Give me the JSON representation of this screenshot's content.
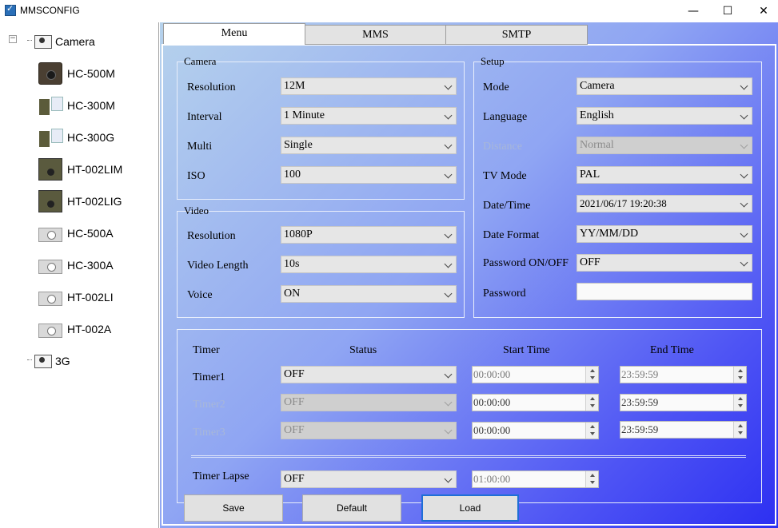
{
  "window": {
    "title": "MMSCONFIG",
    "minimize": "—",
    "maximize": "☐",
    "close": "✕"
  },
  "sidebar": {
    "expander": "−",
    "root": "Camera",
    "items": [
      "HC-500M",
      "HC-300M",
      "HC-300G",
      "HT-002LIM",
      "HT-002LIG",
      "HC-500A",
      "HC-300A",
      "HT-002LI",
      "HT-002A"
    ],
    "second_root": "3G"
  },
  "tabs": [
    "Menu",
    "MMS",
    "SMTP"
  ],
  "camera": {
    "title": "Camera",
    "resolution_label": "Resolution",
    "resolution": "12M",
    "interval_label": "Interval",
    "interval": "1 Minute",
    "multi_label": "Multi",
    "multi": "Single",
    "iso_label": "ISO",
    "iso": "100"
  },
  "video": {
    "title": "Video",
    "resolution_label": "Resolution",
    "resolution": "1080P",
    "length_label": "Video Length",
    "length": "10s",
    "voice_label": "Voice",
    "voice": "ON"
  },
  "setup": {
    "title": "Setup",
    "mode_label": "Mode",
    "mode": "Camera",
    "language_label": "Language",
    "language": "English",
    "distance_label": "Distance",
    "distance": "Normal",
    "tv_mode_label": "TV Mode",
    "tv_mode": "PAL",
    "datetime_label": "Date/Time",
    "datetime": "2021/06/17 19:20:38",
    "date_format_label": "Date Format",
    "date_format": "YY/MM/DD",
    "password_onoff_label": "Password ON/OFF",
    "password_onoff": "OFF",
    "password_label": "Password",
    "password": ""
  },
  "timer": {
    "header_timer": "Timer",
    "header_status": "Status",
    "header_start": "Start Time",
    "header_end": "End Time",
    "rows": [
      {
        "label": "Timer1",
        "status": "OFF",
        "start": "00:00:00",
        "end": "23:59:59"
      },
      {
        "label": "Timer2",
        "status": "OFF",
        "start": "00:00:00",
        "end": "23:59:59"
      },
      {
        "label": "Timer3",
        "status": "OFF",
        "start": "00:00:00",
        "end": "23:59:59"
      }
    ],
    "lapse_label": "Timer Lapse",
    "lapse_status": "OFF",
    "lapse_time": "01:00:00"
  },
  "buttons": {
    "save": "Save",
    "default": "Default",
    "load": "Load"
  }
}
